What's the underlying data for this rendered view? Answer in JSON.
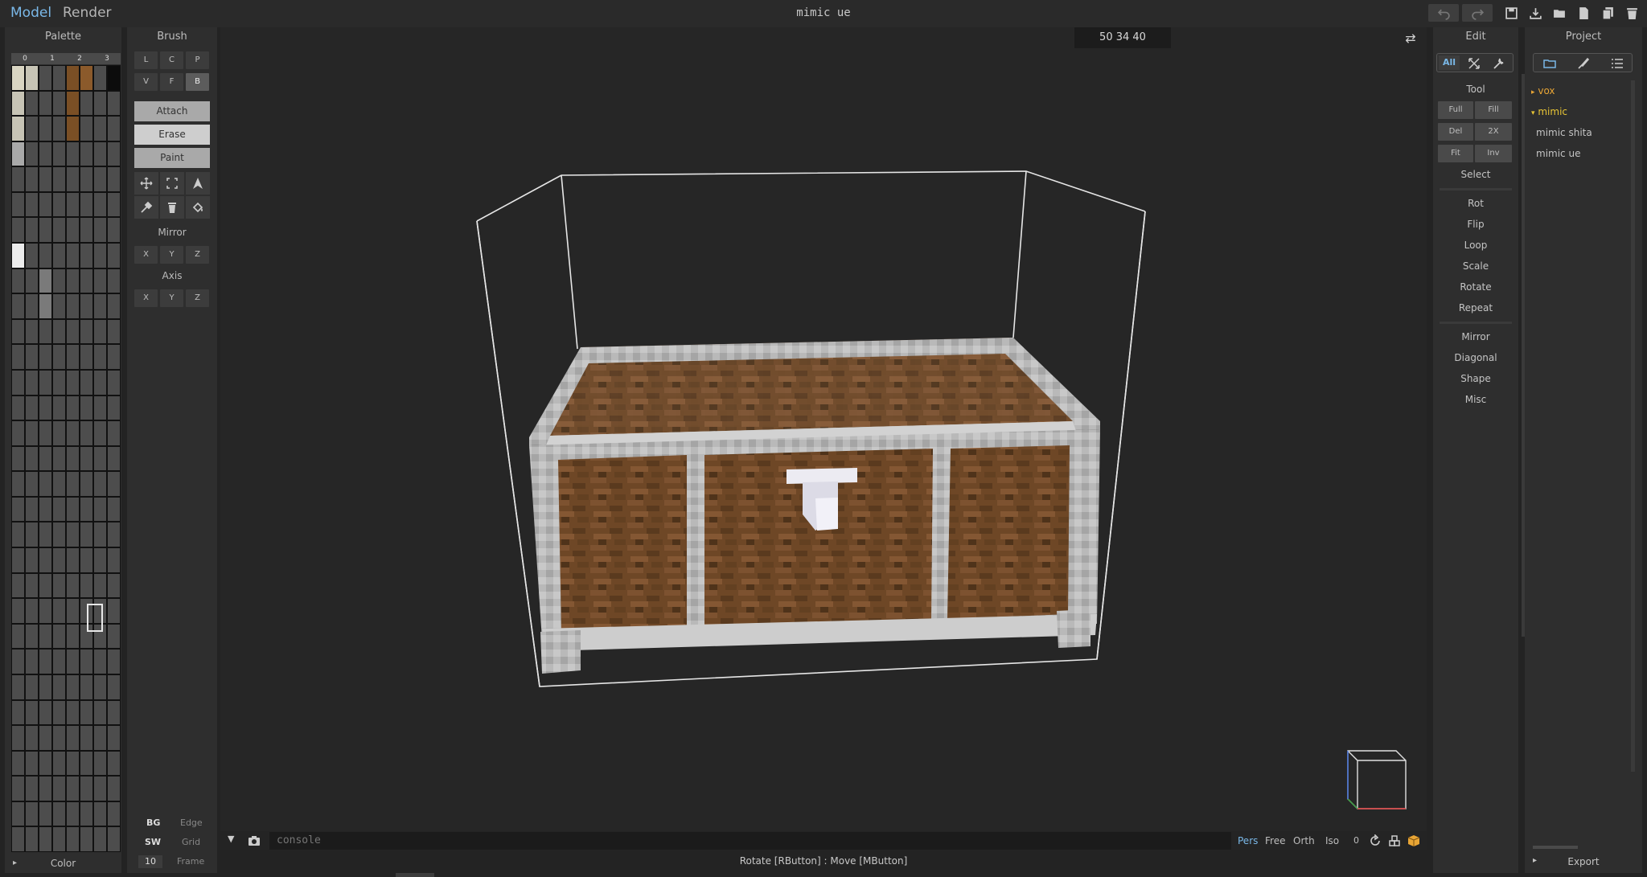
{
  "menubar": {
    "model_label": "Model",
    "render_label": "Render",
    "title": "mimic ue",
    "icons": [
      "undo-icon",
      "redo-icon",
      "save-icon",
      "import-icon",
      "open-folder-icon",
      "new-file-icon",
      "duplicate-icon",
      "delete-icon"
    ]
  },
  "palette": {
    "title": "Palette",
    "tabs": [
      "0",
      "1",
      "2",
      "3"
    ],
    "footer_label": "Color",
    "colors": {
      "cream": "#d9d5c2",
      "pale": "#c7c4b5",
      "grey": "#a9a9a9",
      "brown": "#7a4f25",
      "brown2": "#8b5a2b",
      "black": "#0c0c0c",
      "white": "#ececec",
      "mid": "#7a7a7a",
      "empty": "#4d4d4d"
    }
  },
  "brush": {
    "title": "Brush",
    "row1": [
      "L",
      "C",
      "P"
    ],
    "row2": [
      "V",
      "F",
      "B"
    ],
    "modes": [
      "Attach",
      "Erase",
      "Paint"
    ],
    "mirror_label": "Mirror",
    "axis_label": "Axis",
    "axes": [
      "X",
      "Y",
      "Z"
    ],
    "tools": [
      "move-icon",
      "select-box-icon",
      "fill-arrow-icon",
      "picker-icon",
      "trash-icon",
      "bucket-icon"
    ],
    "bottom": {
      "bg": "BG",
      "edge": "Edge",
      "sw": "SW",
      "grid": "Grid",
      "frame_value": "10",
      "frame": "Frame"
    }
  },
  "viewport": {
    "coords": "50 34 40",
    "console_placeholder": "console",
    "camera_modes": [
      "Pers",
      "Free",
      "Orth",
      "Iso"
    ],
    "zero": "0",
    "status": "Rotate [RButton] : Move [MButton]",
    "active_mode": "Pers",
    "accent": "#7ab8e8"
  },
  "edit": {
    "title": "Edit",
    "top_tabs": [
      "All"
    ],
    "tool_label": "Tool",
    "tool_grid": [
      "Full",
      "Fill",
      "Del",
      "2X",
      "Fit",
      "Inv"
    ],
    "select_label": "Select",
    "group1": [
      "Rot",
      "Flip",
      "Loop",
      "Scale",
      "Rotate",
      "Repeat"
    ],
    "group2": [
      "Mirror",
      "Diagonal",
      "Shape",
      "Misc"
    ]
  },
  "project": {
    "title": "Project",
    "items": [
      {
        "label": "vox",
        "folder": true,
        "color": "#e8a535"
      },
      {
        "label": "mimic",
        "folder": true,
        "color": "#e8c535"
      },
      {
        "label": "mimic shita",
        "folder": false,
        "color": "#c4c4c4"
      },
      {
        "label": "mimic ue",
        "folder": false,
        "color": "#c4c4c4"
      }
    ],
    "footer": "Export"
  }
}
